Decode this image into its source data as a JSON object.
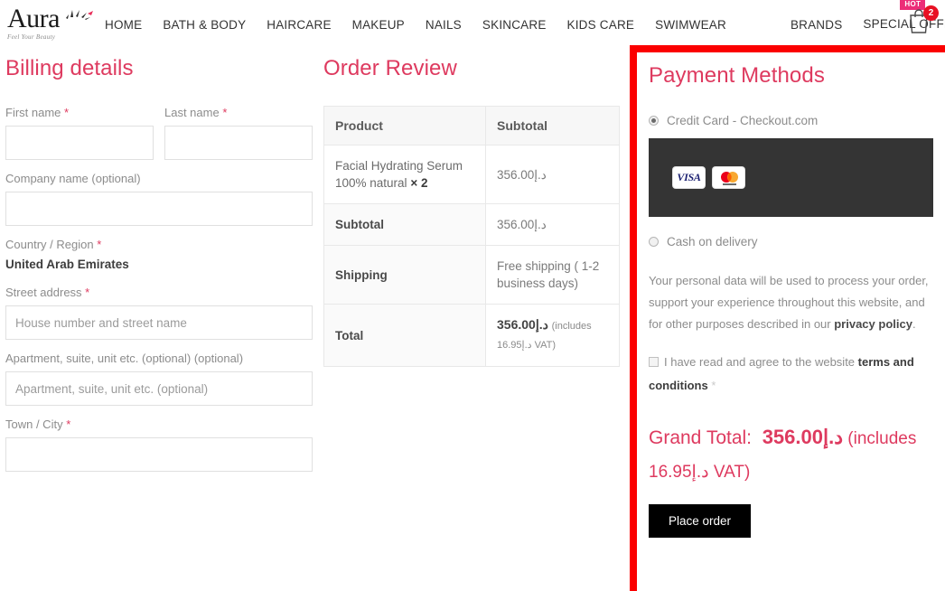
{
  "header": {
    "logo_word": "Aura",
    "logo_tagline": "Feel Your Beauty",
    "nav_items": [
      {
        "label": "HOME"
      },
      {
        "label": "BATH & BODY"
      },
      {
        "label": "HAIRCARE"
      },
      {
        "label": "MAKEUP"
      },
      {
        "label": "NAILS"
      },
      {
        "label": "SKINCARE"
      },
      {
        "label": "KIDS CARE"
      },
      {
        "label": "SWIMWEAR"
      }
    ],
    "nav_right": [
      {
        "label": "BRANDS"
      },
      {
        "label": "SPECIAL OFFER !"
      }
    ],
    "hot_badge": "HOT",
    "cart_count": "2"
  },
  "billing": {
    "title": "Billing details",
    "first_name": {
      "label": "First name",
      "required": "*",
      "value": "",
      "placeholder": ""
    },
    "last_name": {
      "label": "Last name",
      "required": "*",
      "value": "",
      "placeholder": ""
    },
    "company": {
      "label": "Company name (optional)",
      "value": "",
      "placeholder": ""
    },
    "country": {
      "label": "Country / Region",
      "required": "*",
      "value": "United Arab Emirates"
    },
    "street": {
      "label": "Street address",
      "required": "*",
      "value": "",
      "placeholder": "House number and street name"
    },
    "apartment": {
      "label": "Apartment, suite, unit etc. (optional) (optional)",
      "value": "",
      "placeholder": "Apartment, suite, unit etc. (optional)"
    },
    "town": {
      "label": "Town / City",
      "required": "*",
      "value": "",
      "placeholder": ""
    }
  },
  "order": {
    "title": "Order Review",
    "columns": [
      "Product",
      "Subtotal"
    ],
    "rows": [
      {
        "label": "Facial Hydrating Serum 100% natural",
        "qty": "× 2",
        "value": "356.00د.إ",
        "type": "product"
      },
      {
        "label": "Subtotal",
        "value": "356.00د.إ",
        "type": "line"
      },
      {
        "label": "Shipping",
        "value": "Free shipping ( 1-2 business days)",
        "type": "line"
      },
      {
        "label": "Total",
        "value": "356.00د.إ",
        "note": "(includes 16.95د.إ VAT)",
        "type": "total"
      }
    ]
  },
  "payment": {
    "title": "Payment Methods",
    "options": [
      {
        "label": "Credit Card - Checkout.com",
        "selected": true
      },
      {
        "label": "Cash on delivery",
        "selected": false
      }
    ],
    "card_brands": [
      "VISA",
      "Mastercard"
    ],
    "privacy_text_1": "Your personal data will be used to process your order, support your experience throughout this website, and for other purposes described in our ",
    "privacy_link": "privacy policy",
    "privacy_text_2": ".",
    "terms_text": "I have read and agree to the website ",
    "terms_link": "terms and conditions",
    "terms_required": "*",
    "grand_total_label": "Grand Total:",
    "grand_total_amount": "356.00د.إ",
    "grand_total_note": " (includes 16.95د.إ VAT)",
    "place_order_label": "Place order"
  },
  "colors": {
    "accent": "#de3a5f",
    "highlight_border": "#fb0000",
    "hot_badge": "#ec2e78",
    "cart_badge": "#e81123",
    "card_box": "#343434"
  }
}
